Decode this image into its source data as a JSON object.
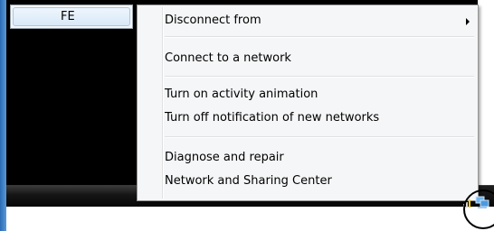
{
  "context_menu": {
    "network_name": "FE",
    "items": [
      {
        "label": "Disconnect from",
        "has_submenu": true
      },
      {
        "label": "Connect to a network"
      },
      {
        "label": "Turn on activity animation"
      },
      {
        "label": "Turn off notification of new networks"
      },
      {
        "label": "Diagnose and repair"
      },
      {
        "label": "Network and Sharing Center"
      }
    ]
  },
  "tray": {
    "icons": [
      "signal-icon",
      "network-icon"
    ]
  }
}
